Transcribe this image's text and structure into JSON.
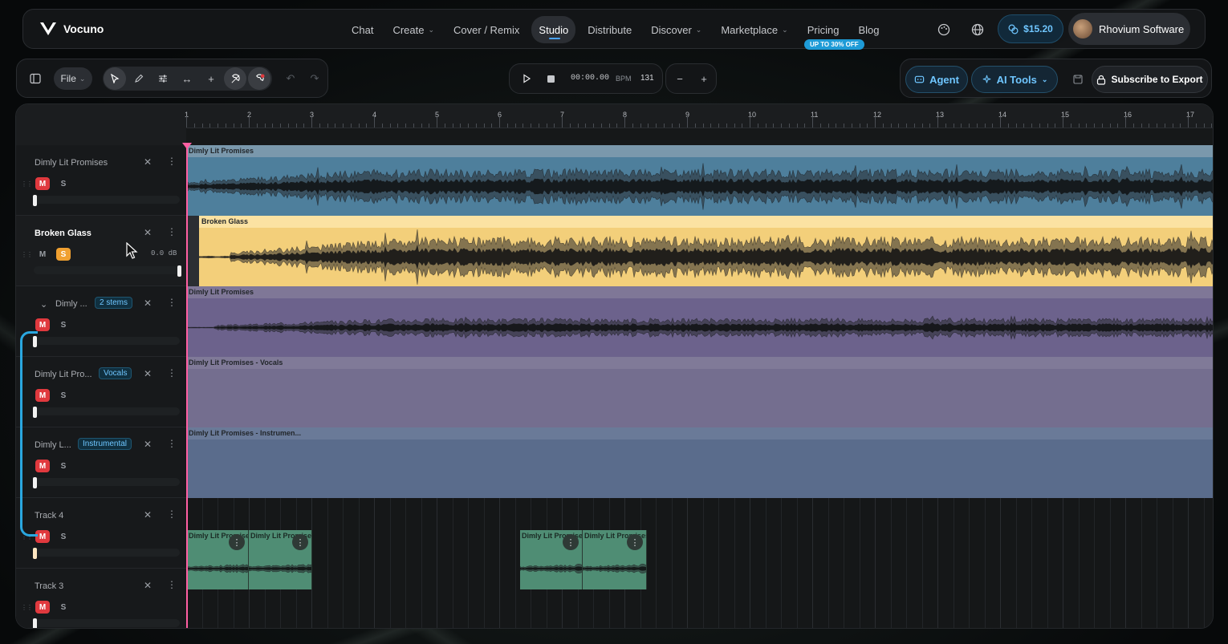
{
  "brand": {
    "name": "Vocuno"
  },
  "nav": {
    "items": [
      {
        "label": "Chat",
        "dropdown": false
      },
      {
        "label": "Create",
        "dropdown": true
      },
      {
        "label": "Cover / Remix",
        "dropdown": false
      },
      {
        "label": "Studio",
        "dropdown": false,
        "active": true
      },
      {
        "label": "Distribute",
        "dropdown": false
      },
      {
        "label": "Discover",
        "dropdown": true
      },
      {
        "label": "Marketplace",
        "dropdown": true
      },
      {
        "label": "Pricing",
        "dropdown": false
      },
      {
        "label": "Blog",
        "dropdown": false
      }
    ],
    "promo_badge": "UP TO 30% OFF",
    "credits": "$15.20",
    "user_name": "Rhovium Software"
  },
  "toolbar": {
    "file_label": "File",
    "time": "00:00.00",
    "bpm_label": "BPM",
    "bpm_value": "131",
    "agent_label": "Agent",
    "ai_tools_label": "AI Tools",
    "export_label": "Subscribe to Export"
  },
  "ruler": {
    "bars": [
      "1",
      "2",
      "3",
      "4",
      "5",
      "6",
      "7",
      "8",
      "9",
      "10",
      "11",
      "12",
      "13",
      "14",
      "15",
      "16",
      "17"
    ]
  },
  "tracks": [
    {
      "name": "Dimly Lit Promises",
      "mute": true,
      "solo": false,
      "clip_title": "Dimly Lit Promises",
      "color": "#4e7f9c",
      "header_color": "#7a98ac"
    },
    {
      "name": "Broken Glass",
      "mute": false,
      "solo": true,
      "db": "0.0 dB",
      "clip_title": "Broken Glass",
      "color": "#f3cf7a",
      "header_color": "#fbe2a2"
    },
    {
      "name": "Dimly ...",
      "badge": "2 stems",
      "mute": true,
      "solo": false,
      "clip_title": "Dimly Lit Promises",
      "color": "#6c628c",
      "header_color": "#7f7797"
    },
    {
      "name": "Dimly Lit Pro...",
      "badge": "Vocals",
      "mute": true,
      "solo": false,
      "clip_title": "Dimly Lit Promises - Vocals",
      "color": "#746e8f",
      "header_color": "#807a98"
    },
    {
      "name": "Dimly L...",
      "badge": "Instrumental",
      "mute": true,
      "solo": false,
      "clip_title": "Dimly Lit Promises - Instrumen...",
      "color": "#5a6c8c",
      "header_color": "#6a7a98"
    },
    {
      "name": "Track 4",
      "mute": true,
      "solo": false
    },
    {
      "name": "Track 3",
      "mute": true,
      "solo": false
    }
  ],
  "track3_clips": [
    {
      "title": "Dimly Lit Promises"
    },
    {
      "title": "Dimly Lit Promises"
    },
    {
      "title": "Dimly Lit Promises"
    },
    {
      "title": "Dimly Lit Promises"
    }
  ]
}
